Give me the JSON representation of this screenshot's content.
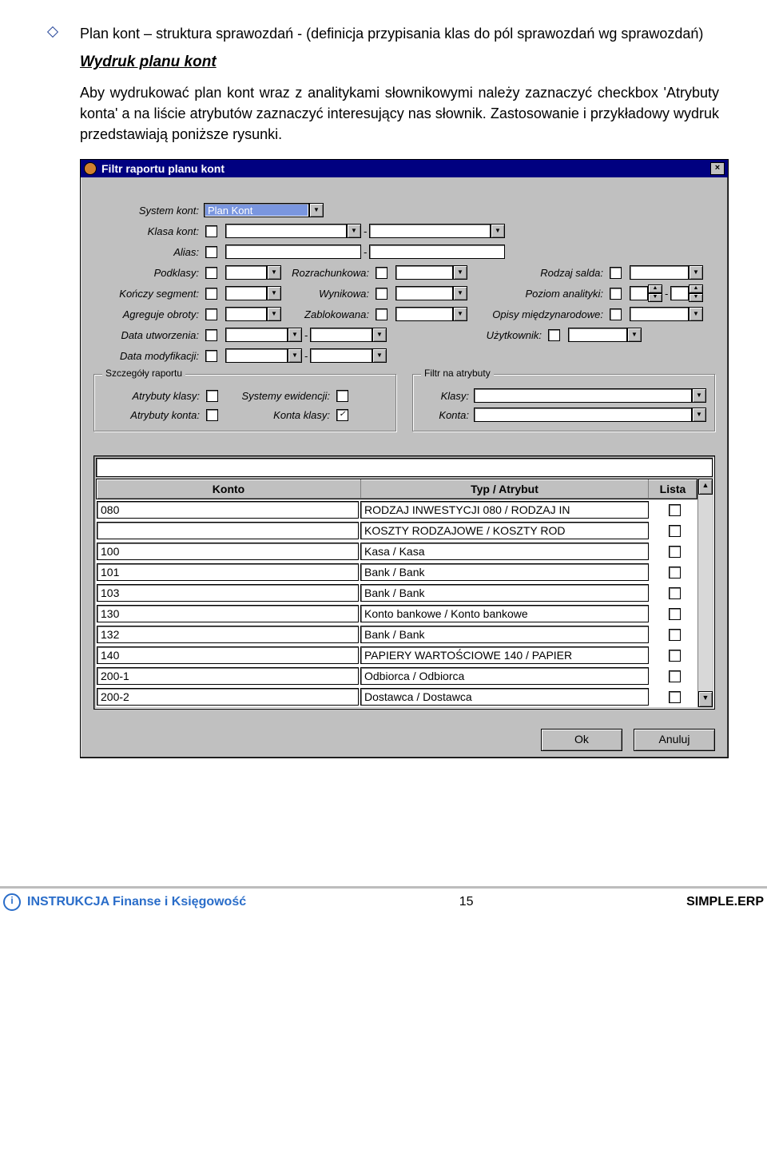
{
  "header": {
    "bullet_text": "Plan kont – struktura sprawozdań - (definicja przypisania klas do pól sprawozdań wg sprawozdań)",
    "section_heading": "Wydruk planu kont",
    "paragraph": "Aby wydrukować plan kont wraz z analitykami słownikowymi należy zaznaczyć checkbox 'Atrybuty konta' a na liście atrybutów zaznaczyć interesujący nas słownik. Zastosowanie i przykładowy wydruk przedstawiają poniższe rysunki."
  },
  "dialog": {
    "title": "Filtr raportu planu kont",
    "labels": {
      "system_kont": "System kont:",
      "klasa_kont": "Klasa kont:",
      "alias": "Alias:",
      "podklasy": "Podklasy:",
      "rozrachunkowa": "Rozrachunkowa:",
      "rodzaj_salda": "Rodzaj salda:",
      "konczy_segment": "Kończy segment:",
      "wynikowa": "Wynikowa:",
      "poziom_analityki": "Poziom analityki:",
      "agreguje_obroty": "Agreguje obroty:",
      "zablokowana": "Zablokowana:",
      "opisy_miedzynarodowe": "Opisy międzynarodowe:",
      "data_utworzenia": "Data utworzenia:",
      "uzytkownik": "Użytkownik:",
      "data_modyfikacji": "Data modyfikacji:"
    },
    "system_kont_value": "Plan Kont",
    "group_szczegoly": {
      "legend": "Szczegóły raportu",
      "atrybuty_klasy": "Atrybuty klasy:",
      "atrybuty_konta": "Atrybuty konta:",
      "systemy_ewidencji": "Systemy ewidencji:",
      "konta_klasy": "Konta klasy:"
    },
    "group_filtr": {
      "legend": "Filtr na atrybuty",
      "klasy": "Klasy:",
      "konta": "Konta:"
    },
    "table": {
      "col_konto": "Konto",
      "col_typ": "Typ / Atrybut",
      "col_lista": "Lista",
      "rows": [
        {
          "konto": "080",
          "typ": "RODZAJ INWESTYCJI 080 / RODZAJ IN"
        },
        {
          "konto": "",
          "typ": "KOSZTY RODZAJOWE / KOSZTY ROD"
        },
        {
          "konto": "100",
          "typ": "Kasa / Kasa"
        },
        {
          "konto": "101",
          "typ": "Bank / Bank"
        },
        {
          "konto": "103",
          "typ": "Bank / Bank"
        },
        {
          "konto": "130",
          "typ": "Konto bankowe / Konto bankowe"
        },
        {
          "konto": "132",
          "typ": "Bank / Bank"
        },
        {
          "konto": "140",
          "typ": "PAPIERY WARTOŚCIOWE 140 / PAPIER"
        },
        {
          "konto": "200-1",
          "typ": "Odbiorca / Odbiorca"
        },
        {
          "konto": "200-2",
          "typ": "Dostawca / Dostawca"
        }
      ]
    },
    "buttons": {
      "ok": "Ok",
      "anuluj": "Anuluj"
    }
  },
  "footer": {
    "left": "INSTRUKCJA Finanse i Księgowość",
    "page": "15",
    "right": "SIMPLE.ERP"
  }
}
